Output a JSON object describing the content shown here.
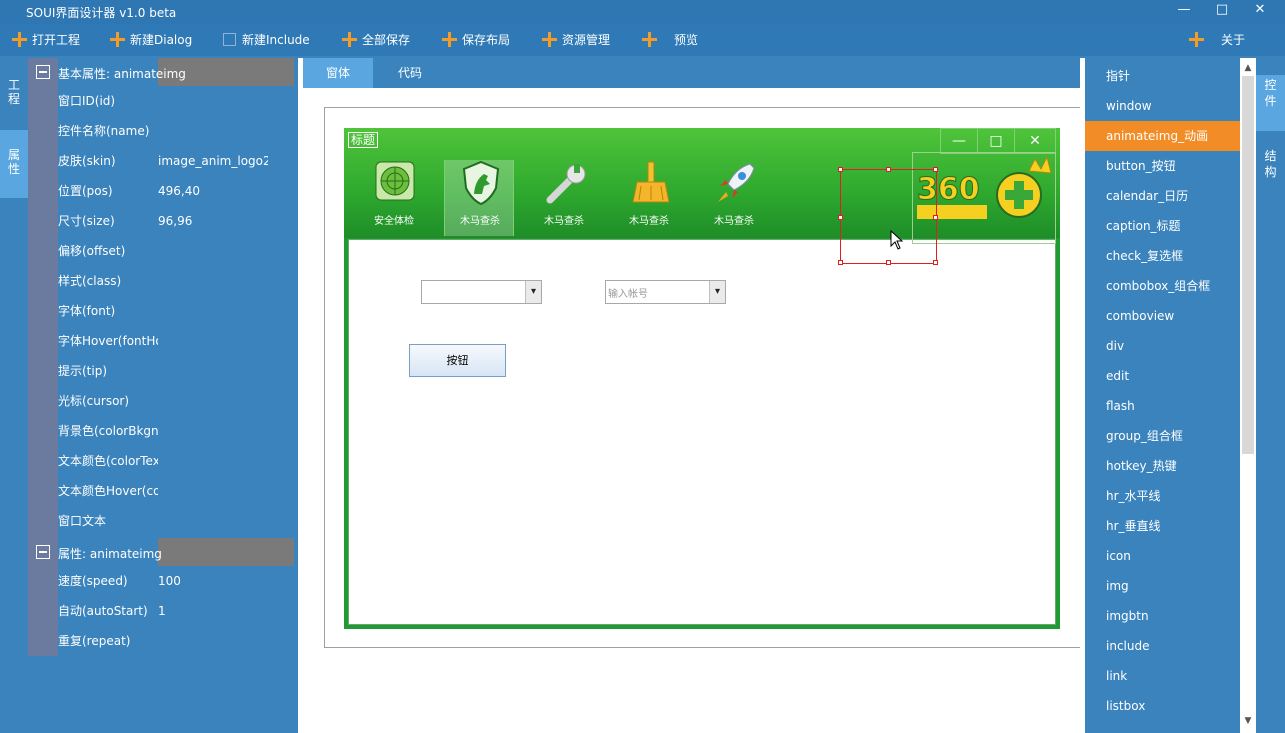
{
  "app": {
    "title": "SOUI界面设计器 v1.0 beta"
  },
  "window_controls": {
    "min": "—",
    "max": "□",
    "close": "✕"
  },
  "toolbar": {
    "open_project": "打开工程",
    "new_dialog": "新建Dialog",
    "new_include": "新建Include",
    "save_all": "全部保存",
    "save_layout": "保存布局",
    "resource_mgr": "资源管理",
    "preview": "预览",
    "about": "关于"
  },
  "left_tabs": {
    "project": "工\n程",
    "property": "属\n性"
  },
  "props": {
    "basic_header": "基本属性: animateimg",
    "basic_rows": [
      {
        "key": "窗口ID(id)",
        "value": ""
      },
      {
        "key": "控件名称(name)",
        "value": ""
      },
      {
        "key": "皮肤(skin)",
        "value": "image_anim_logo2"
      },
      {
        "key": "位置(pos)",
        "value": "496,40"
      },
      {
        "key": "尺寸(size)",
        "value": "96,96"
      },
      {
        "key": "偏移(offset)",
        "value": ""
      },
      {
        "key": "样式(class)",
        "value": ""
      },
      {
        "key": "字体(font)",
        "value": ""
      },
      {
        "key": "字体Hover(fontHover)",
        "value": ""
      },
      {
        "key": "提示(tip)",
        "value": ""
      },
      {
        "key": "光标(cursor)",
        "value": ""
      },
      {
        "key": "背景色(colorBkgnd)",
        "value": ""
      },
      {
        "key": "文本颜色(colorText)",
        "value": ""
      },
      {
        "key": "文本颜色Hover(colorTextHover)",
        "value": ""
      },
      {
        "key": "窗口文本",
        "value": ""
      }
    ],
    "attr_header": "属性: animateimg",
    "attr_rows": [
      {
        "key": "速度(speed)",
        "value": "100"
      },
      {
        "key": "自动(autoStart)",
        "value": "1"
      },
      {
        "key": "重复(repeat)",
        "value": ""
      }
    ]
  },
  "center_tabs": {
    "window": "窗体",
    "code": "代码"
  },
  "dialog": {
    "title": "标题",
    "tools": [
      "安全体检",
      "木马查杀",
      "木马查杀",
      "木马查杀",
      "木马查杀"
    ],
    "combo2_placeholder": "输入帐号",
    "button_label": "按钮",
    "combo_arrow": "▾"
  },
  "right_list": {
    "items": [
      "指针",
      "window",
      "animateimg_动画",
      "button_按钮",
      "calendar_日历",
      "caption_标题",
      "check_复选框",
      "combobox_组合框",
      "comboview",
      "div",
      "edit",
      "flash",
      "group_组合框",
      "hotkey_热键",
      "hr_水平线",
      "hr_垂直线",
      "icon",
      "img",
      "imgbtn",
      "include",
      "link",
      "listbox"
    ],
    "selected_index": 2
  },
  "right_tabs": {
    "controls": "控\n件",
    "structure": "结\n构"
  },
  "colors": {
    "accent": "#f28c26",
    "bg": "#3a83bd",
    "dialog_green": "#1f9a34"
  }
}
